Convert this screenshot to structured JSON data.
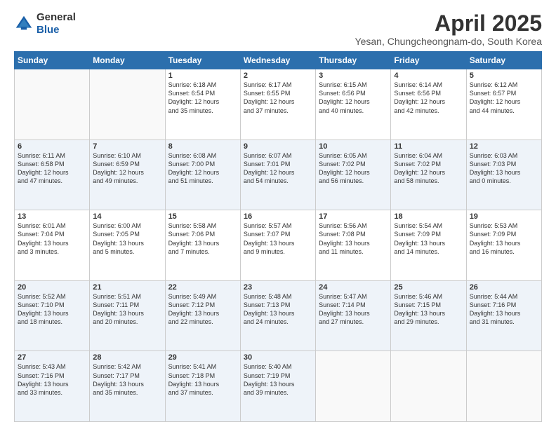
{
  "header": {
    "logo_line1": "General",
    "logo_line2": "Blue",
    "month": "April 2025",
    "location": "Yesan, Chungcheongnam-do, South Korea"
  },
  "days_of_week": [
    "Sunday",
    "Monday",
    "Tuesday",
    "Wednesday",
    "Thursday",
    "Friday",
    "Saturday"
  ],
  "weeks": [
    [
      {
        "day": "",
        "info": ""
      },
      {
        "day": "",
        "info": ""
      },
      {
        "day": "1",
        "info": "Sunrise: 6:18 AM\nSunset: 6:54 PM\nDaylight: 12 hours\nand 35 minutes."
      },
      {
        "day": "2",
        "info": "Sunrise: 6:17 AM\nSunset: 6:55 PM\nDaylight: 12 hours\nand 37 minutes."
      },
      {
        "day": "3",
        "info": "Sunrise: 6:15 AM\nSunset: 6:56 PM\nDaylight: 12 hours\nand 40 minutes."
      },
      {
        "day": "4",
        "info": "Sunrise: 6:14 AM\nSunset: 6:56 PM\nDaylight: 12 hours\nand 42 minutes."
      },
      {
        "day": "5",
        "info": "Sunrise: 6:12 AM\nSunset: 6:57 PM\nDaylight: 12 hours\nand 44 minutes."
      }
    ],
    [
      {
        "day": "6",
        "info": "Sunrise: 6:11 AM\nSunset: 6:58 PM\nDaylight: 12 hours\nand 47 minutes."
      },
      {
        "day": "7",
        "info": "Sunrise: 6:10 AM\nSunset: 6:59 PM\nDaylight: 12 hours\nand 49 minutes."
      },
      {
        "day": "8",
        "info": "Sunrise: 6:08 AM\nSunset: 7:00 PM\nDaylight: 12 hours\nand 51 minutes."
      },
      {
        "day": "9",
        "info": "Sunrise: 6:07 AM\nSunset: 7:01 PM\nDaylight: 12 hours\nand 54 minutes."
      },
      {
        "day": "10",
        "info": "Sunrise: 6:05 AM\nSunset: 7:02 PM\nDaylight: 12 hours\nand 56 minutes."
      },
      {
        "day": "11",
        "info": "Sunrise: 6:04 AM\nSunset: 7:02 PM\nDaylight: 12 hours\nand 58 minutes."
      },
      {
        "day": "12",
        "info": "Sunrise: 6:03 AM\nSunset: 7:03 PM\nDaylight: 13 hours\nand 0 minutes."
      }
    ],
    [
      {
        "day": "13",
        "info": "Sunrise: 6:01 AM\nSunset: 7:04 PM\nDaylight: 13 hours\nand 3 minutes."
      },
      {
        "day": "14",
        "info": "Sunrise: 6:00 AM\nSunset: 7:05 PM\nDaylight: 13 hours\nand 5 minutes."
      },
      {
        "day": "15",
        "info": "Sunrise: 5:58 AM\nSunset: 7:06 PM\nDaylight: 13 hours\nand 7 minutes."
      },
      {
        "day": "16",
        "info": "Sunrise: 5:57 AM\nSunset: 7:07 PM\nDaylight: 13 hours\nand 9 minutes."
      },
      {
        "day": "17",
        "info": "Sunrise: 5:56 AM\nSunset: 7:08 PM\nDaylight: 13 hours\nand 11 minutes."
      },
      {
        "day": "18",
        "info": "Sunrise: 5:54 AM\nSunset: 7:09 PM\nDaylight: 13 hours\nand 14 minutes."
      },
      {
        "day": "19",
        "info": "Sunrise: 5:53 AM\nSunset: 7:09 PM\nDaylight: 13 hours\nand 16 minutes."
      }
    ],
    [
      {
        "day": "20",
        "info": "Sunrise: 5:52 AM\nSunset: 7:10 PM\nDaylight: 13 hours\nand 18 minutes."
      },
      {
        "day": "21",
        "info": "Sunrise: 5:51 AM\nSunset: 7:11 PM\nDaylight: 13 hours\nand 20 minutes."
      },
      {
        "day": "22",
        "info": "Sunrise: 5:49 AM\nSunset: 7:12 PM\nDaylight: 13 hours\nand 22 minutes."
      },
      {
        "day": "23",
        "info": "Sunrise: 5:48 AM\nSunset: 7:13 PM\nDaylight: 13 hours\nand 24 minutes."
      },
      {
        "day": "24",
        "info": "Sunrise: 5:47 AM\nSunset: 7:14 PM\nDaylight: 13 hours\nand 27 minutes."
      },
      {
        "day": "25",
        "info": "Sunrise: 5:46 AM\nSunset: 7:15 PM\nDaylight: 13 hours\nand 29 minutes."
      },
      {
        "day": "26",
        "info": "Sunrise: 5:44 AM\nSunset: 7:16 PM\nDaylight: 13 hours\nand 31 minutes."
      }
    ],
    [
      {
        "day": "27",
        "info": "Sunrise: 5:43 AM\nSunset: 7:16 PM\nDaylight: 13 hours\nand 33 minutes."
      },
      {
        "day": "28",
        "info": "Sunrise: 5:42 AM\nSunset: 7:17 PM\nDaylight: 13 hours\nand 35 minutes."
      },
      {
        "day": "29",
        "info": "Sunrise: 5:41 AM\nSunset: 7:18 PM\nDaylight: 13 hours\nand 37 minutes."
      },
      {
        "day": "30",
        "info": "Sunrise: 5:40 AM\nSunset: 7:19 PM\nDaylight: 13 hours\nand 39 minutes."
      },
      {
        "day": "",
        "info": ""
      },
      {
        "day": "",
        "info": ""
      },
      {
        "day": "",
        "info": ""
      }
    ]
  ]
}
